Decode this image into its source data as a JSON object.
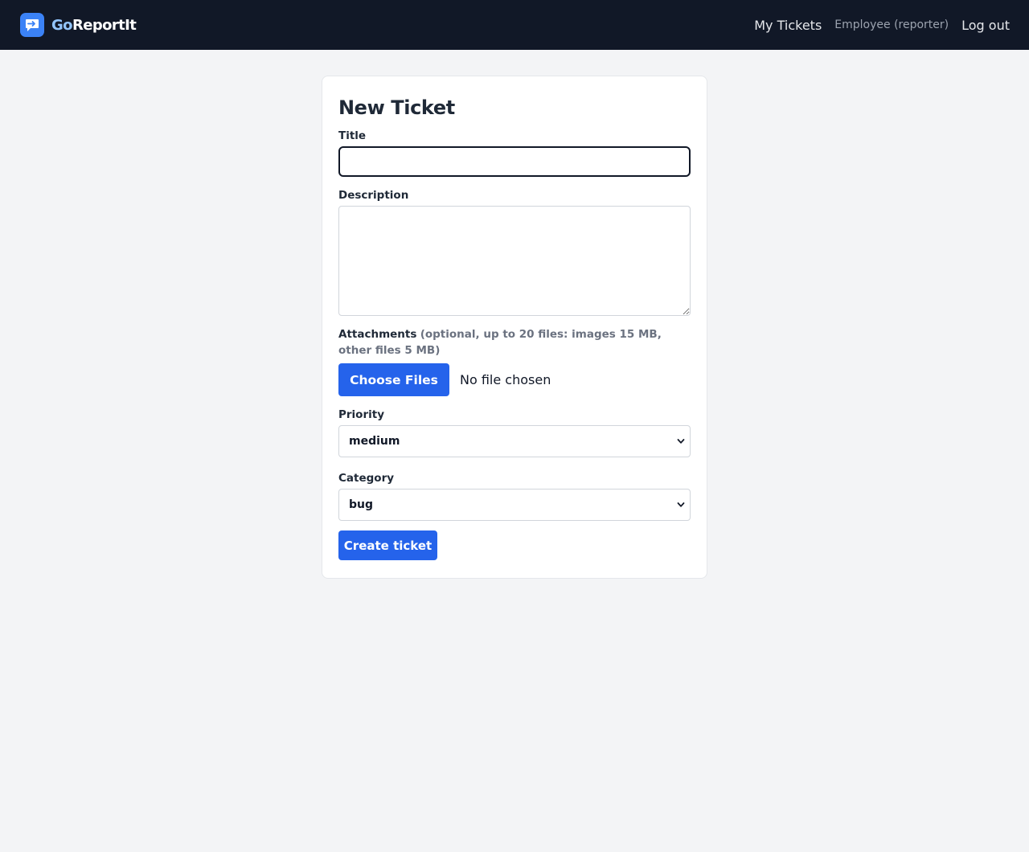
{
  "header": {
    "brand_prefix": "Go",
    "brand_suffix": "ReportIt",
    "nav_my_tickets": "My Tickets",
    "user_role": "Employee (reporter)",
    "logout": "Log out"
  },
  "form": {
    "title": "New Ticket",
    "title_label": "Title",
    "title_value": "",
    "description_label": "Description",
    "description_value": "",
    "attachments_label": "Attachments",
    "attachments_hint": "(optional, up to 20 files: images 15 MB, other files 5 MB)",
    "choose_files": "Choose Files",
    "file_status": "No file chosen",
    "priority_label": "Priority",
    "priority_value": "medium",
    "category_label": "Category",
    "category_value": "bug",
    "submit": "Create ticket"
  },
  "colors": {
    "header_bg": "#111827",
    "accent": "#2563eb",
    "page_bg": "#f3f4f6"
  },
  "icons": {
    "logo": "chat-bubble-arrow-icon",
    "select_arrow": "chevron-down-icon"
  }
}
